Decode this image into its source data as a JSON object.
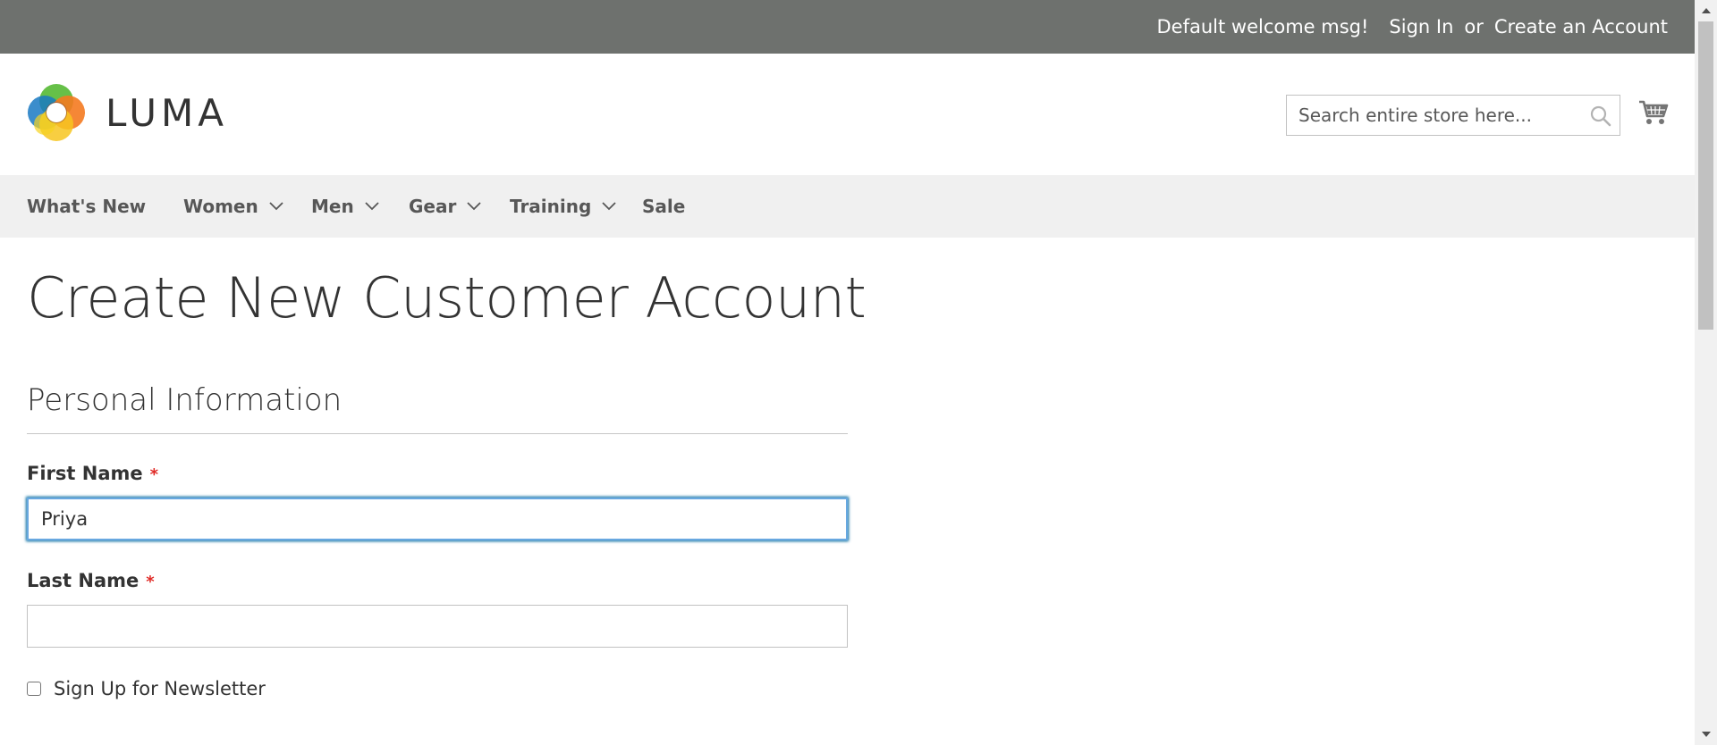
{
  "topbar": {
    "welcome": "Default welcome msg!",
    "sign_in": "Sign In",
    "or": "or",
    "create_account": "Create an Account"
  },
  "header": {
    "logo_text": "LUMA",
    "search_placeholder": "Search entire store here...",
    "cart_icon": "shopping-cart-icon",
    "search_icon": "magnifier-icon"
  },
  "nav": {
    "items": [
      {
        "label": "What's New",
        "has_dropdown": false
      },
      {
        "label": "Women",
        "has_dropdown": true
      },
      {
        "label": "Men",
        "has_dropdown": true
      },
      {
        "label": "Gear",
        "has_dropdown": true
      },
      {
        "label": "Training",
        "has_dropdown": true
      },
      {
        "label": "Sale",
        "has_dropdown": false
      }
    ]
  },
  "main": {
    "title": "Create New Customer Account",
    "section_title": "Personal Information",
    "fields": {
      "first_name": {
        "label": "First Name",
        "required_mark": "*",
        "value": "Priya"
      },
      "last_name": {
        "label": "Last Name",
        "required_mark": "*",
        "value": ""
      }
    },
    "newsletter": {
      "label": "Sign Up for Newsletter",
      "checked": false
    }
  },
  "colors": {
    "topbar_bg": "#6e716e",
    "nav_bg": "#f0f0f0",
    "required": "#e02b27",
    "focus_border": "#68a8e0"
  }
}
